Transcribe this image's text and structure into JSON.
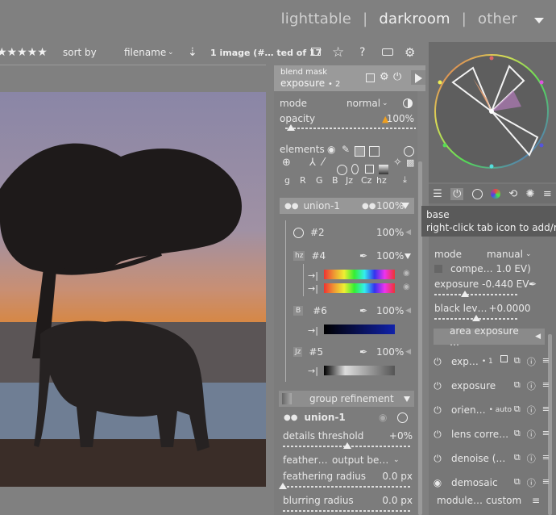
{
  "views": {
    "lighttable": "lighttable",
    "sep1": "|",
    "darkroom": "darkroom",
    "sep2": "|",
    "other": "other",
    "menu_icon": "triangle-down-icon"
  },
  "topbar": {
    "stars": "★★★★★",
    "sort_label": "sort by",
    "sort_value": "filename",
    "image_info": "1 image (#… ted of 17"
  },
  "blend_header": {
    "line1": "blend mask",
    "line2": "exposure",
    "line2_suffix": "• 2"
  },
  "blend": {
    "mode_label": "mode",
    "mode_value": "normal",
    "opacity_label": "opacity",
    "opacity_value": "100%",
    "opacity_fraction": 1.0,
    "elements_label": "elements",
    "channels": [
      "g",
      "R",
      "G",
      "B",
      "Jz",
      "Cz",
      "hz"
    ],
    "union_label": "union-1",
    "union_value": "100%",
    "items": [
      {
        "id": "#2",
        "value": "100%",
        "tag": ""
      },
      {
        "id": "#4",
        "value": "100%",
        "tag": "hz"
      },
      {
        "id": "#6",
        "value": "100%",
        "tag": "B"
      },
      {
        "id": "#5",
        "value": "100%",
        "tag": "Jz"
      }
    ],
    "group_refinement_label": "group refinement",
    "union2_label": "union-1",
    "details_label": "details threshold",
    "details_value": "+0%",
    "feather_label": "feather…",
    "output_label": "output be…",
    "feathering_label": "feathering radius",
    "feathering_value": "0.0 px",
    "blurring_label": "blurring radius",
    "blurring_value": "0.0 px"
  },
  "right": {
    "mode_label": "mode",
    "mode_value": "manual",
    "comp_label": "compe… 1.0 EV)",
    "exposure_label": "exposure",
    "exposure_value": "-0.440 EV",
    "black_label": "black lev…",
    "black_value": "+0.0000",
    "area_label": "area exposure …",
    "modules": [
      {
        "name": "exp…",
        "badge": "• 1"
      },
      {
        "name": "exposure",
        "badge": ""
      },
      {
        "name": "orien…",
        "badge": "• auto"
      },
      {
        "name": "lens corre…",
        "badge": ""
      },
      {
        "name": "denoise (…",
        "badge": ""
      },
      {
        "name": "demosaic",
        "badge": ""
      }
    ],
    "preset_label": "module…",
    "preset_value": "custom"
  },
  "tooltip": {
    "line1": "base",
    "line2": "right-click tab icon to add/remove modules"
  },
  "colors": {
    "accent": "#f0a020",
    "panel": "#7c7c7c"
  }
}
